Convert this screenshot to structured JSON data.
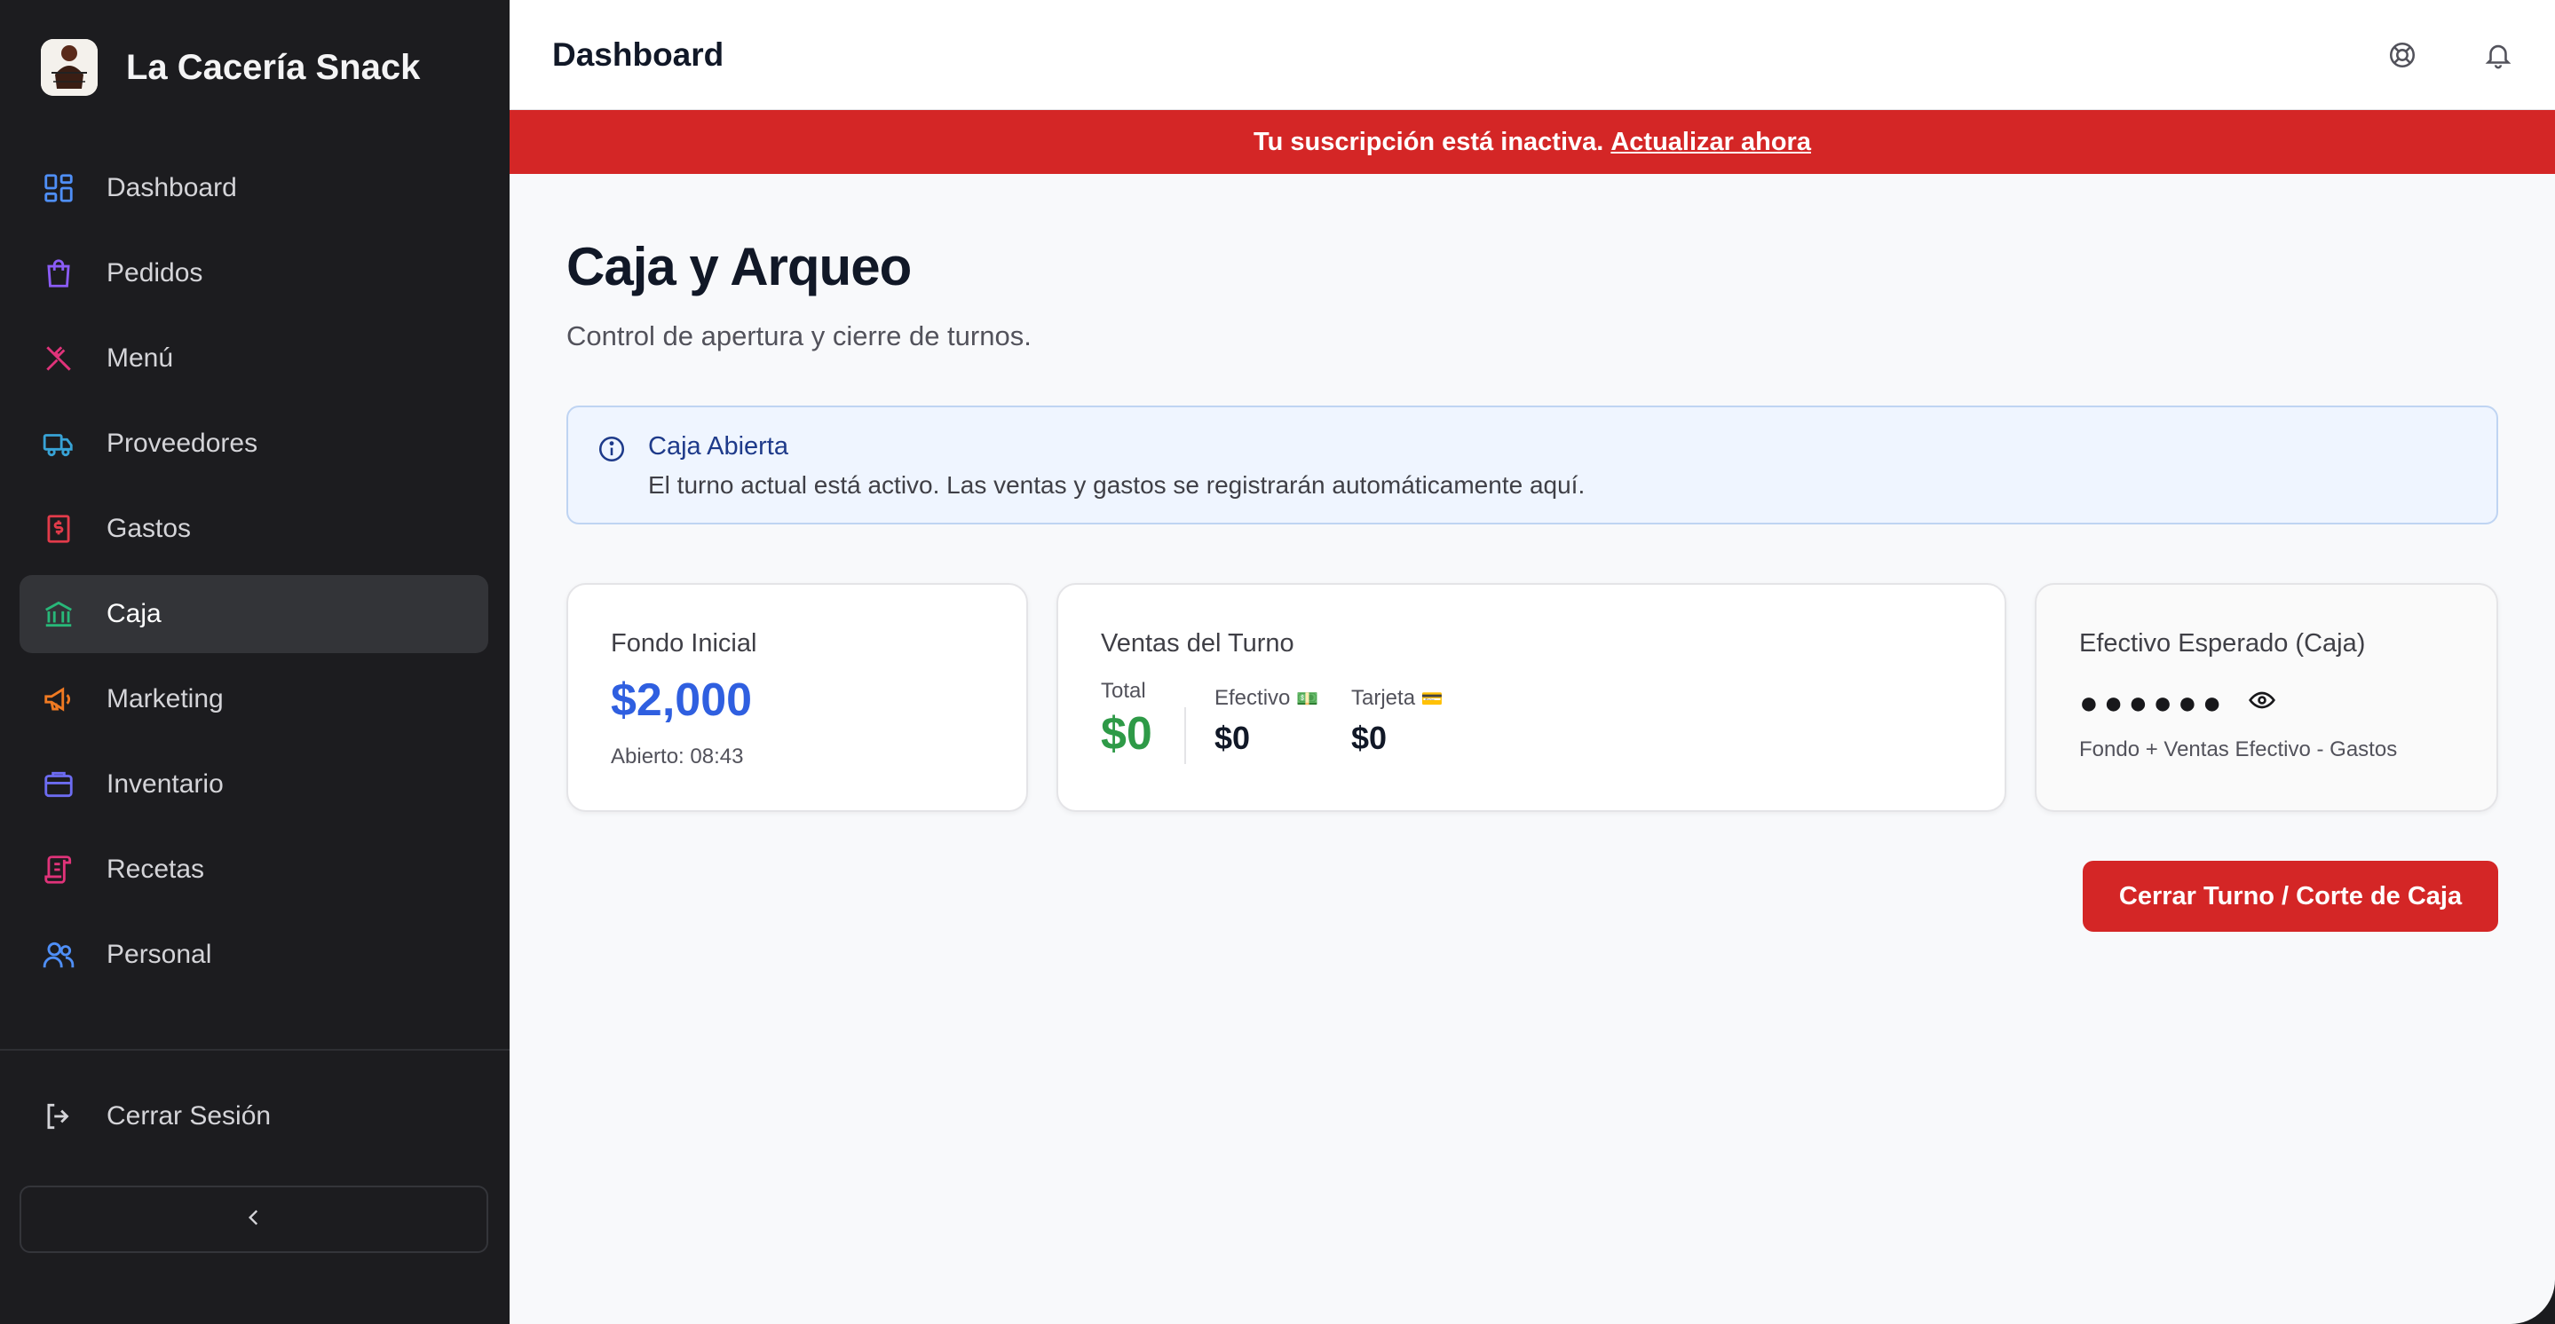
{
  "brand": {
    "name": "La Cacería Snack",
    "logo_icon": "restaurant-logo"
  },
  "sidebar": {
    "items": [
      {
        "label": "Dashboard",
        "icon": "grid-icon",
        "color": "#4f8ff7"
      },
      {
        "label": "Pedidos",
        "icon": "shopping-bag-icon",
        "color": "#8b5cf6"
      },
      {
        "label": "Menú",
        "icon": "utensils-icon",
        "color": "#e0337a"
      },
      {
        "label": "Proveedores",
        "icon": "truck-icon",
        "color": "#38a3d6"
      },
      {
        "label": "Gastos",
        "icon": "receipt-icon",
        "color": "#e23b4a"
      },
      {
        "label": "Caja",
        "icon": "bank-icon",
        "color": "#28b879",
        "active": true
      },
      {
        "label": "Marketing",
        "icon": "megaphone-icon",
        "color": "#f07a22"
      },
      {
        "label": "Inventario",
        "icon": "box-icon",
        "color": "#6d6cf2"
      },
      {
        "label": "Recetas",
        "icon": "scroll-icon",
        "color": "#e0337a"
      },
      {
        "label": "Personal",
        "icon": "users-icon",
        "color": "#4f8ff7"
      }
    ],
    "logout_label": "Cerrar Sesión",
    "collapse_icon": "chevron-left-icon"
  },
  "topbar": {
    "title": "Dashboard",
    "help_icon": "lifebuoy-icon",
    "notifications_icon": "bell-icon"
  },
  "banner": {
    "text": "Tu suscripción está inactiva.",
    "link": "Actualizar ahora",
    "color": "#d42626"
  },
  "page": {
    "title": "Caja y Arqueo",
    "subtitle": "Control de apertura y cierre de turnos."
  },
  "alert": {
    "title": "Caja Abierta",
    "text": "El turno actual está activo. Las ventas y gastos se registrarán automáticamente aquí."
  },
  "cards": {
    "fondo": {
      "label": "Fondo Inicial",
      "value": "$2,000",
      "opened": "Abierto: 08:43"
    },
    "ventas": {
      "label": "Ventas del Turno",
      "total_label": "Total",
      "total_value": "$0",
      "efectivo_label": "Efectivo",
      "efectivo_emoji": "💵",
      "efectivo_value": "$0",
      "tarjeta_label": "Tarjeta",
      "tarjeta_emoji": "💳",
      "tarjeta_value": "$0"
    },
    "esperado": {
      "label": "Efectivo Esperado (Caja)",
      "masked_value": "●●●●●●",
      "formula": "Fondo + Ventas Efectivo - Gastos"
    }
  },
  "actions": {
    "close_shift_label": "Cerrar Turno / Corte de Caja"
  }
}
